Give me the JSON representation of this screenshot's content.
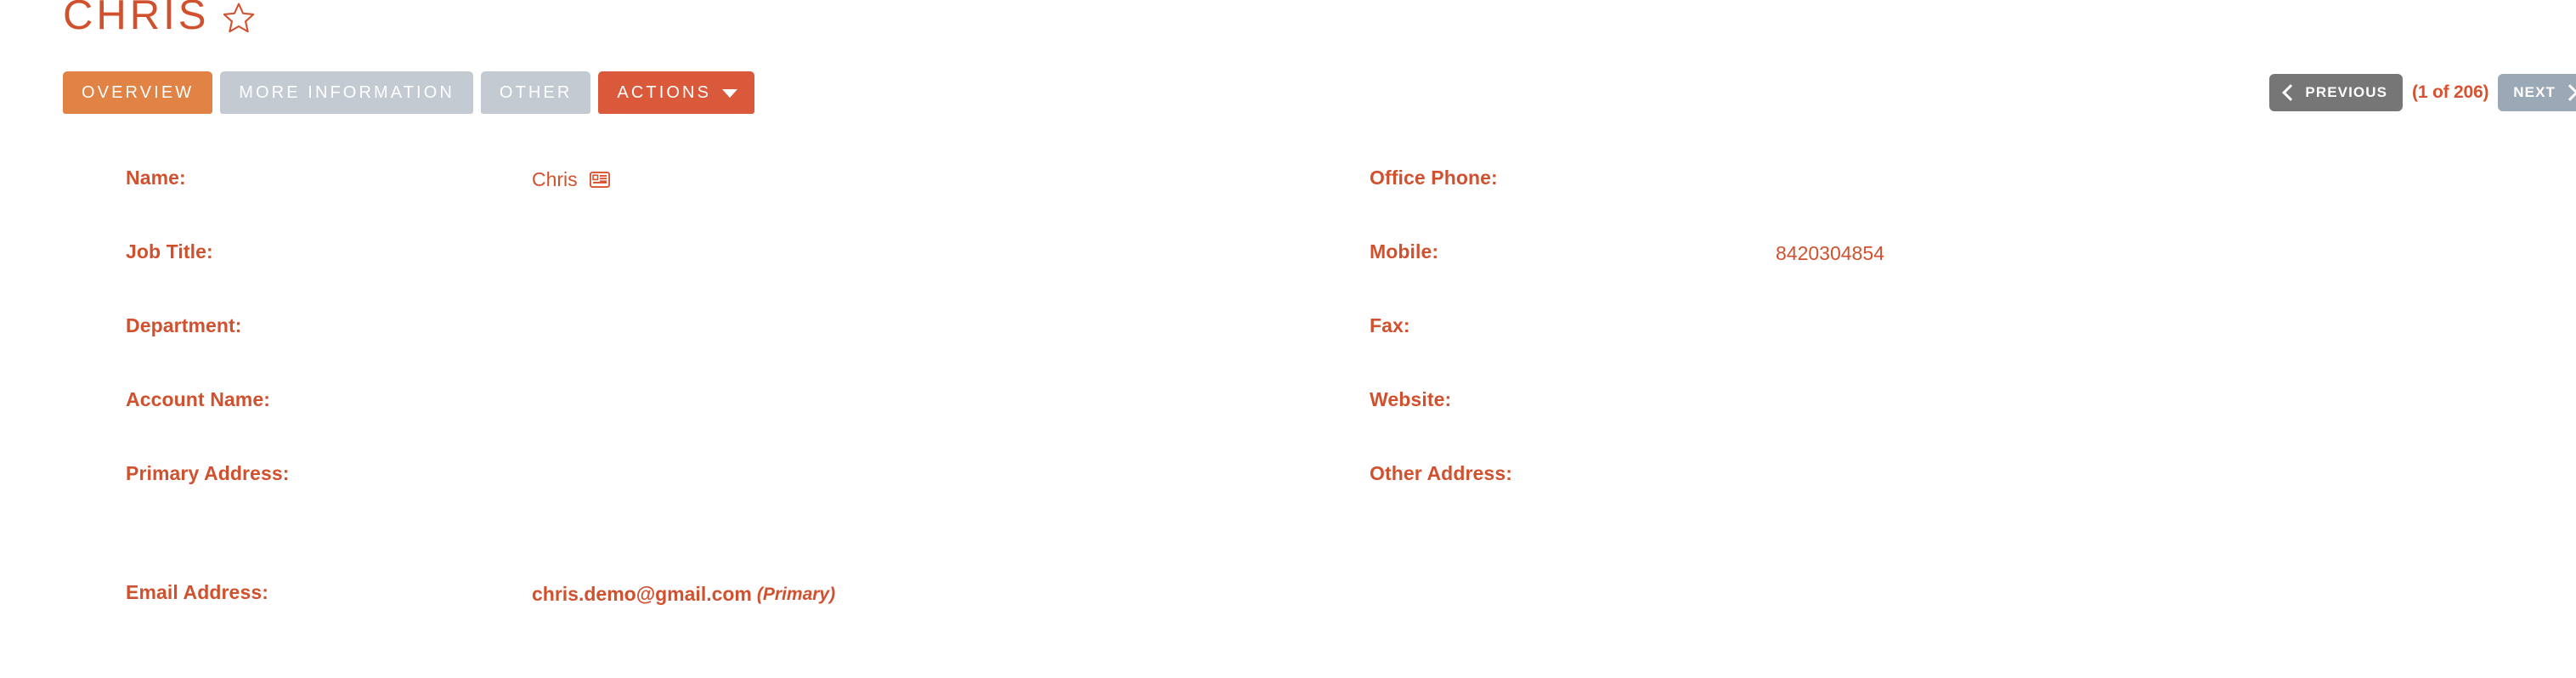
{
  "record": {
    "title": "CHRIS",
    "favorite_icon": "star-icon"
  },
  "tabs": [
    {
      "label": "OVERVIEW",
      "state": "active"
    },
    {
      "label": "MORE INFORMATION",
      "state": "inactive"
    },
    {
      "label": "OTHER",
      "state": "inactive"
    },
    {
      "label": "ACTIONS",
      "state": "dropdown"
    }
  ],
  "pager": {
    "previous_label": "PREVIOUS",
    "next_label": "NEXT",
    "count_label": "(1 of 206)",
    "prev_icon": "chevron-left-icon",
    "next_icon": "chevron-right-icon"
  },
  "fields": {
    "left": [
      {
        "label": "Name:",
        "value": "Chris",
        "icon": "vcard-icon"
      },
      {
        "label": "Job Title:",
        "value": ""
      },
      {
        "label": "Department:",
        "value": ""
      },
      {
        "label": "Account Name:",
        "value": ""
      },
      {
        "label": "Primary Address:",
        "value": ""
      },
      {
        "label": "Email Address:",
        "value": "chris.demo@gmail.com",
        "qualifier": "(Primary)"
      }
    ],
    "right": [
      {
        "label": "Office Phone:",
        "value": ""
      },
      {
        "label": "Mobile:",
        "value": "8420304854"
      },
      {
        "label": "Fax:",
        "value": ""
      },
      {
        "label": "Website:",
        "value": ""
      },
      {
        "label": "Other Address:",
        "value": ""
      }
    ]
  },
  "colors": {
    "brand_red": "#d1512f",
    "tab_active_orange": "#e08344",
    "tab_inactive_gray": "#c3cad1",
    "actions_orange": "#d9593a",
    "prev_gray": "#767676",
    "next_gray": "#9ba8b5"
  }
}
